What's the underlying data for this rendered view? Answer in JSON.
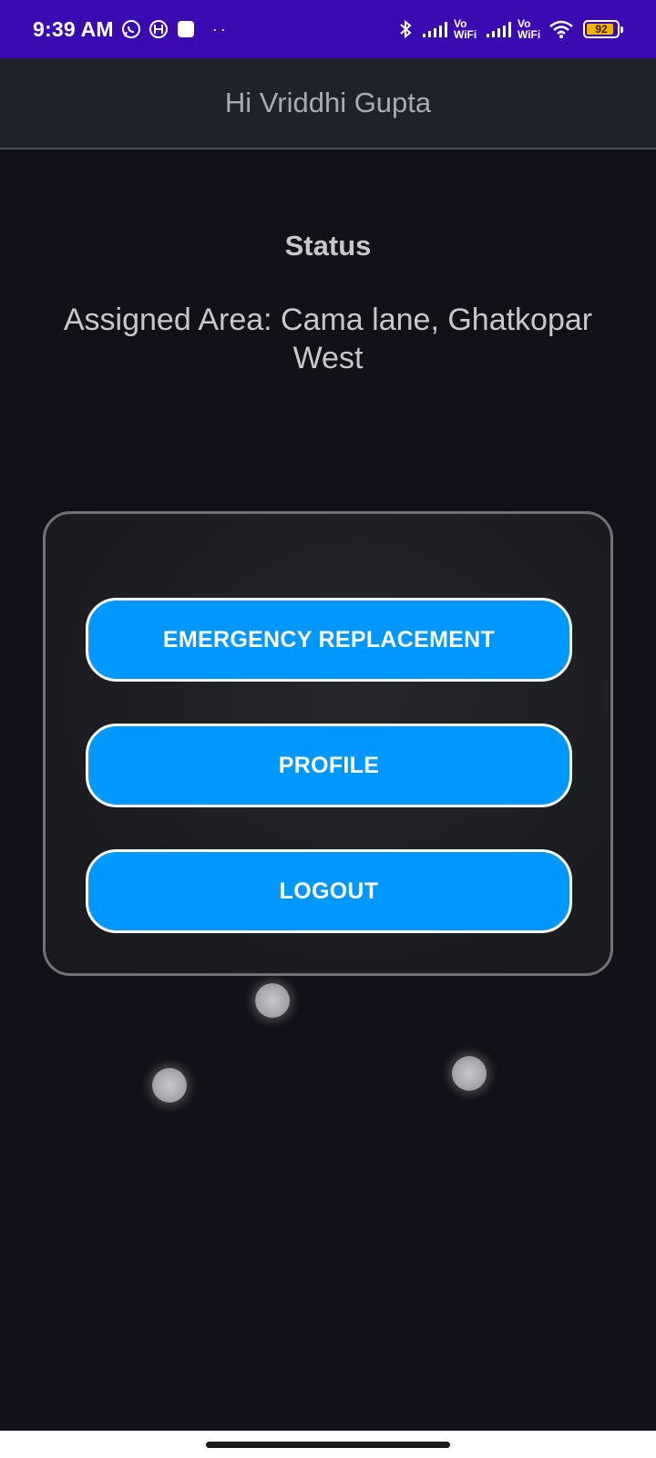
{
  "status_bar": {
    "time": "9:39 AM",
    "notification_icons": [
      "whatsapp-icon",
      "h-circle-icon",
      "square-app-icon"
    ],
    "overflow_dots": "··",
    "system_icons": [
      "bluetooth-icon",
      "signal-icon",
      "vowifi-icon",
      "signal-icon",
      "vowifi-icon",
      "wifi-icon",
      "battery-icon"
    ],
    "vowifi_label_1": "Vo\nWiFi",
    "vowifi_label_2": "Vo\nWiFi",
    "battery_percent": "92",
    "battery_fraction": 0.92,
    "background_color": "#3a0bb0"
  },
  "app_bar": {
    "title": "Hi Vriddhi Gupta"
  },
  "main": {
    "heading": "Status",
    "assigned_area": "Assigned Area: Cama lane, Ghatkopar West"
  },
  "card": {
    "buttons": [
      {
        "label": "EMERGENCY REPLACEMENT"
      },
      {
        "label": "PROFILE"
      },
      {
        "label": "LOGOUT"
      }
    ]
  },
  "colors": {
    "accent_button": "#0098ff",
    "background": "#111119",
    "app_bar": "#1f212b"
  }
}
